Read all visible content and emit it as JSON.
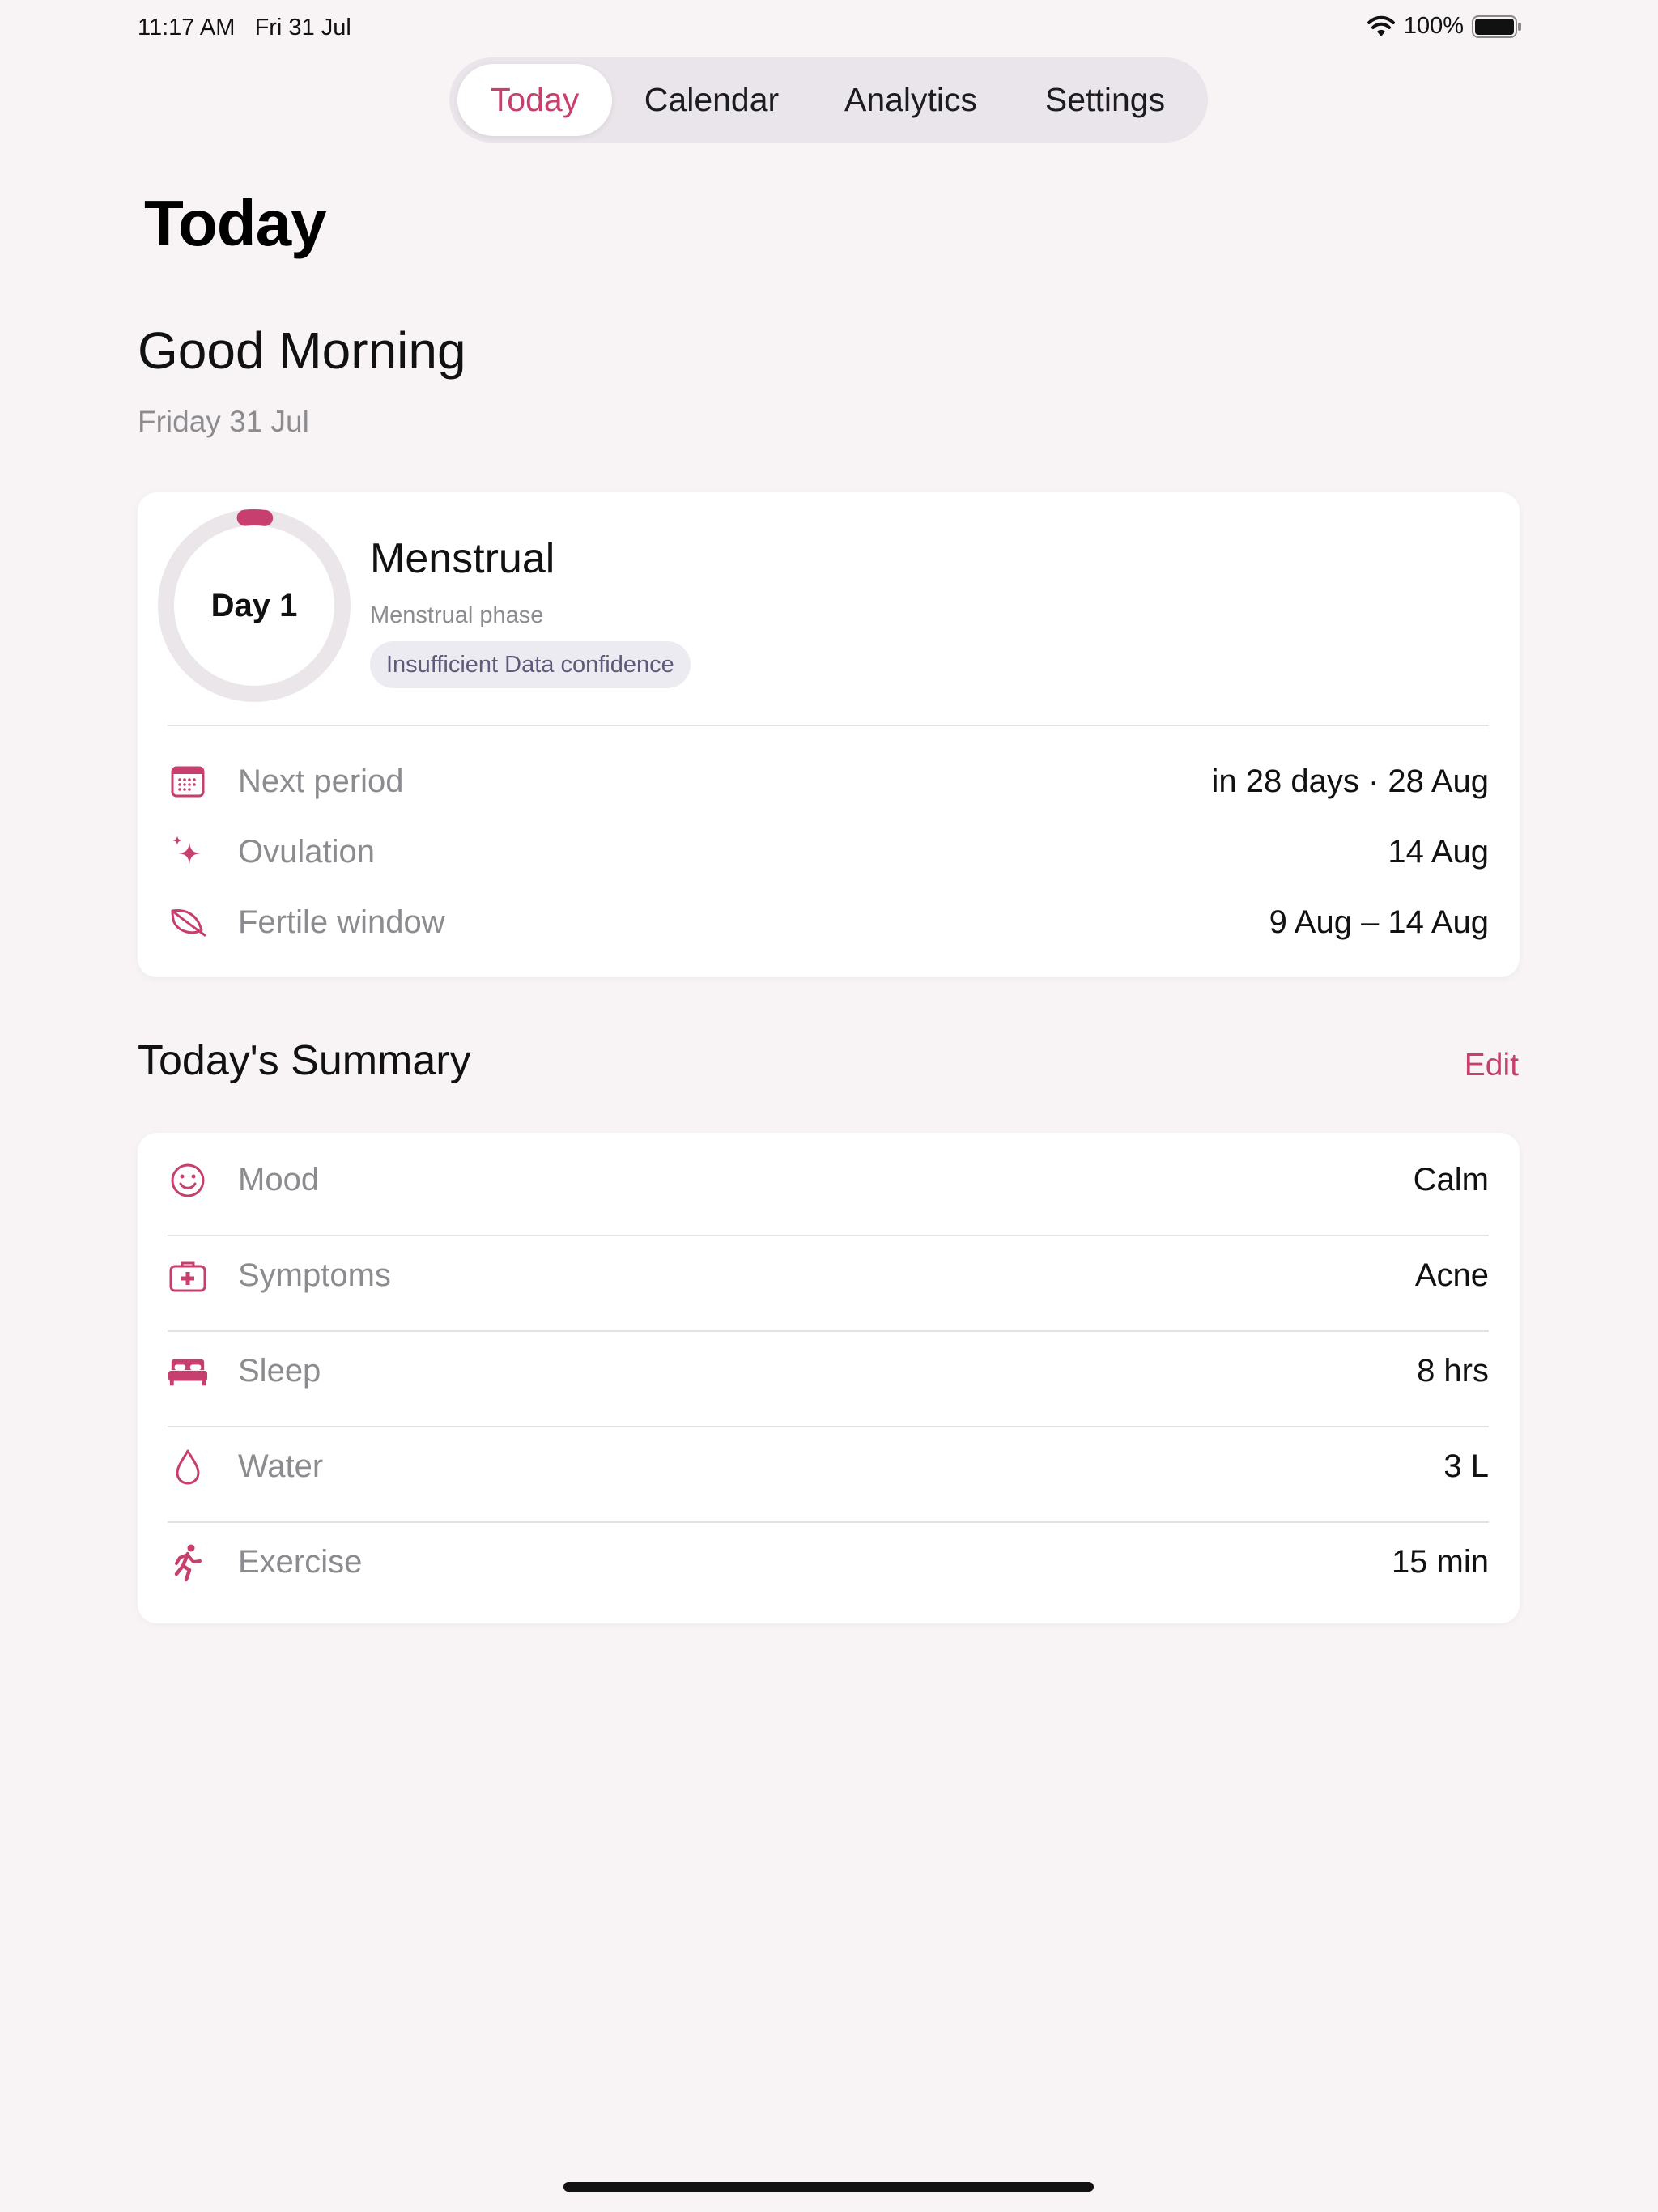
{
  "status_bar": {
    "time": "11:17 AM",
    "date": "Fri 31 Jul",
    "battery": "100%"
  },
  "tabs": [
    {
      "label": "Today",
      "selected": true
    },
    {
      "label": "Calendar",
      "selected": false
    },
    {
      "label": "Analytics",
      "selected": false
    },
    {
      "label": "Settings",
      "selected": false
    }
  ],
  "page_title": "Today",
  "greeting": "Good Morning",
  "date_line": "Friday 31 Jul",
  "cycle": {
    "day_label": "Day 1",
    "cycle_progress": 0.036,
    "phase_title": "Menstrual",
    "phase_subtitle": "Menstrual phase",
    "confidence": "Insufficient Data confidence",
    "rows": [
      {
        "icon": "calendar-icon",
        "label": "Next period",
        "value": "in 28 days · 28 Aug"
      },
      {
        "icon": "sparkle-icon",
        "label": "Ovulation",
        "value": "14 Aug"
      },
      {
        "icon": "leaf-icon",
        "label": "Fertile window",
        "value": "9 Aug – 14 Aug"
      }
    ]
  },
  "summary": {
    "title": "Today's Summary",
    "edit_label": "Edit",
    "rows": [
      {
        "icon": "smiley-icon",
        "label": "Mood",
        "value": "Calm"
      },
      {
        "icon": "medical-kit-icon",
        "label": "Symptoms",
        "value": "Acne"
      },
      {
        "icon": "bed-icon",
        "label": "Sleep",
        "value": "8 hrs"
      },
      {
        "icon": "drop-icon",
        "label": "Water",
        "value": "3 L"
      },
      {
        "icon": "running-figure-icon",
        "label": "Exercise",
        "value": "15 min"
      }
    ]
  },
  "colors": {
    "accent": "#c73f6e",
    "background": "#f8f4f5",
    "ring_track": "#ebe6ea"
  }
}
